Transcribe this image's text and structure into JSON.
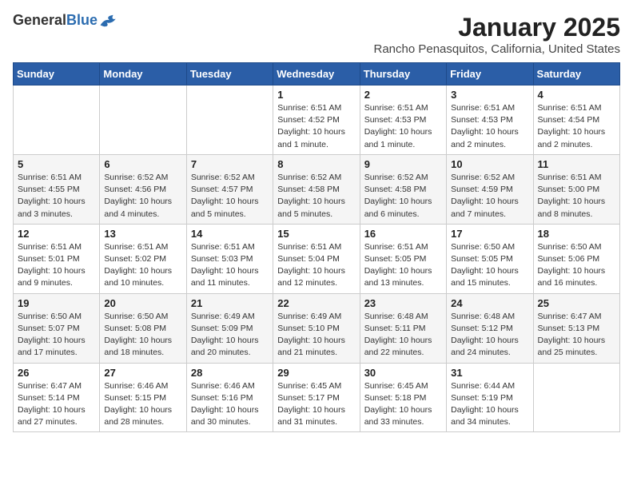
{
  "header": {
    "logo_general": "General",
    "logo_blue": "Blue",
    "month_year": "January 2025",
    "location": "Rancho Penasquitos, California, United States"
  },
  "weekdays": [
    "Sunday",
    "Monday",
    "Tuesday",
    "Wednesday",
    "Thursday",
    "Friday",
    "Saturday"
  ],
  "weeks": [
    [
      {
        "day": "",
        "info": ""
      },
      {
        "day": "",
        "info": ""
      },
      {
        "day": "",
        "info": ""
      },
      {
        "day": "1",
        "info": "Sunrise: 6:51 AM\nSunset: 4:52 PM\nDaylight: 10 hours\nand 1 minute."
      },
      {
        "day": "2",
        "info": "Sunrise: 6:51 AM\nSunset: 4:53 PM\nDaylight: 10 hours\nand 1 minute."
      },
      {
        "day": "3",
        "info": "Sunrise: 6:51 AM\nSunset: 4:53 PM\nDaylight: 10 hours\nand 2 minutes."
      },
      {
        "day": "4",
        "info": "Sunrise: 6:51 AM\nSunset: 4:54 PM\nDaylight: 10 hours\nand 2 minutes."
      }
    ],
    [
      {
        "day": "5",
        "info": "Sunrise: 6:51 AM\nSunset: 4:55 PM\nDaylight: 10 hours\nand 3 minutes."
      },
      {
        "day": "6",
        "info": "Sunrise: 6:52 AM\nSunset: 4:56 PM\nDaylight: 10 hours\nand 4 minutes."
      },
      {
        "day": "7",
        "info": "Sunrise: 6:52 AM\nSunset: 4:57 PM\nDaylight: 10 hours\nand 5 minutes."
      },
      {
        "day": "8",
        "info": "Sunrise: 6:52 AM\nSunset: 4:58 PM\nDaylight: 10 hours\nand 5 minutes."
      },
      {
        "day": "9",
        "info": "Sunrise: 6:52 AM\nSunset: 4:58 PM\nDaylight: 10 hours\nand 6 minutes."
      },
      {
        "day": "10",
        "info": "Sunrise: 6:52 AM\nSunset: 4:59 PM\nDaylight: 10 hours\nand 7 minutes."
      },
      {
        "day": "11",
        "info": "Sunrise: 6:51 AM\nSunset: 5:00 PM\nDaylight: 10 hours\nand 8 minutes."
      }
    ],
    [
      {
        "day": "12",
        "info": "Sunrise: 6:51 AM\nSunset: 5:01 PM\nDaylight: 10 hours\nand 9 minutes."
      },
      {
        "day": "13",
        "info": "Sunrise: 6:51 AM\nSunset: 5:02 PM\nDaylight: 10 hours\nand 10 minutes."
      },
      {
        "day": "14",
        "info": "Sunrise: 6:51 AM\nSunset: 5:03 PM\nDaylight: 10 hours\nand 11 minutes."
      },
      {
        "day": "15",
        "info": "Sunrise: 6:51 AM\nSunset: 5:04 PM\nDaylight: 10 hours\nand 12 minutes."
      },
      {
        "day": "16",
        "info": "Sunrise: 6:51 AM\nSunset: 5:05 PM\nDaylight: 10 hours\nand 13 minutes."
      },
      {
        "day": "17",
        "info": "Sunrise: 6:50 AM\nSunset: 5:05 PM\nDaylight: 10 hours\nand 15 minutes."
      },
      {
        "day": "18",
        "info": "Sunrise: 6:50 AM\nSunset: 5:06 PM\nDaylight: 10 hours\nand 16 minutes."
      }
    ],
    [
      {
        "day": "19",
        "info": "Sunrise: 6:50 AM\nSunset: 5:07 PM\nDaylight: 10 hours\nand 17 minutes."
      },
      {
        "day": "20",
        "info": "Sunrise: 6:50 AM\nSunset: 5:08 PM\nDaylight: 10 hours\nand 18 minutes."
      },
      {
        "day": "21",
        "info": "Sunrise: 6:49 AM\nSunset: 5:09 PM\nDaylight: 10 hours\nand 20 minutes."
      },
      {
        "day": "22",
        "info": "Sunrise: 6:49 AM\nSunset: 5:10 PM\nDaylight: 10 hours\nand 21 minutes."
      },
      {
        "day": "23",
        "info": "Sunrise: 6:48 AM\nSunset: 5:11 PM\nDaylight: 10 hours\nand 22 minutes."
      },
      {
        "day": "24",
        "info": "Sunrise: 6:48 AM\nSunset: 5:12 PM\nDaylight: 10 hours\nand 24 minutes."
      },
      {
        "day": "25",
        "info": "Sunrise: 6:47 AM\nSunset: 5:13 PM\nDaylight: 10 hours\nand 25 minutes."
      }
    ],
    [
      {
        "day": "26",
        "info": "Sunrise: 6:47 AM\nSunset: 5:14 PM\nDaylight: 10 hours\nand 27 minutes."
      },
      {
        "day": "27",
        "info": "Sunrise: 6:46 AM\nSunset: 5:15 PM\nDaylight: 10 hours\nand 28 minutes."
      },
      {
        "day": "28",
        "info": "Sunrise: 6:46 AM\nSunset: 5:16 PM\nDaylight: 10 hours\nand 30 minutes."
      },
      {
        "day": "29",
        "info": "Sunrise: 6:45 AM\nSunset: 5:17 PM\nDaylight: 10 hours\nand 31 minutes."
      },
      {
        "day": "30",
        "info": "Sunrise: 6:45 AM\nSunset: 5:18 PM\nDaylight: 10 hours\nand 33 minutes."
      },
      {
        "day": "31",
        "info": "Sunrise: 6:44 AM\nSunset: 5:19 PM\nDaylight: 10 hours\nand 34 minutes."
      },
      {
        "day": "",
        "info": ""
      }
    ]
  ]
}
